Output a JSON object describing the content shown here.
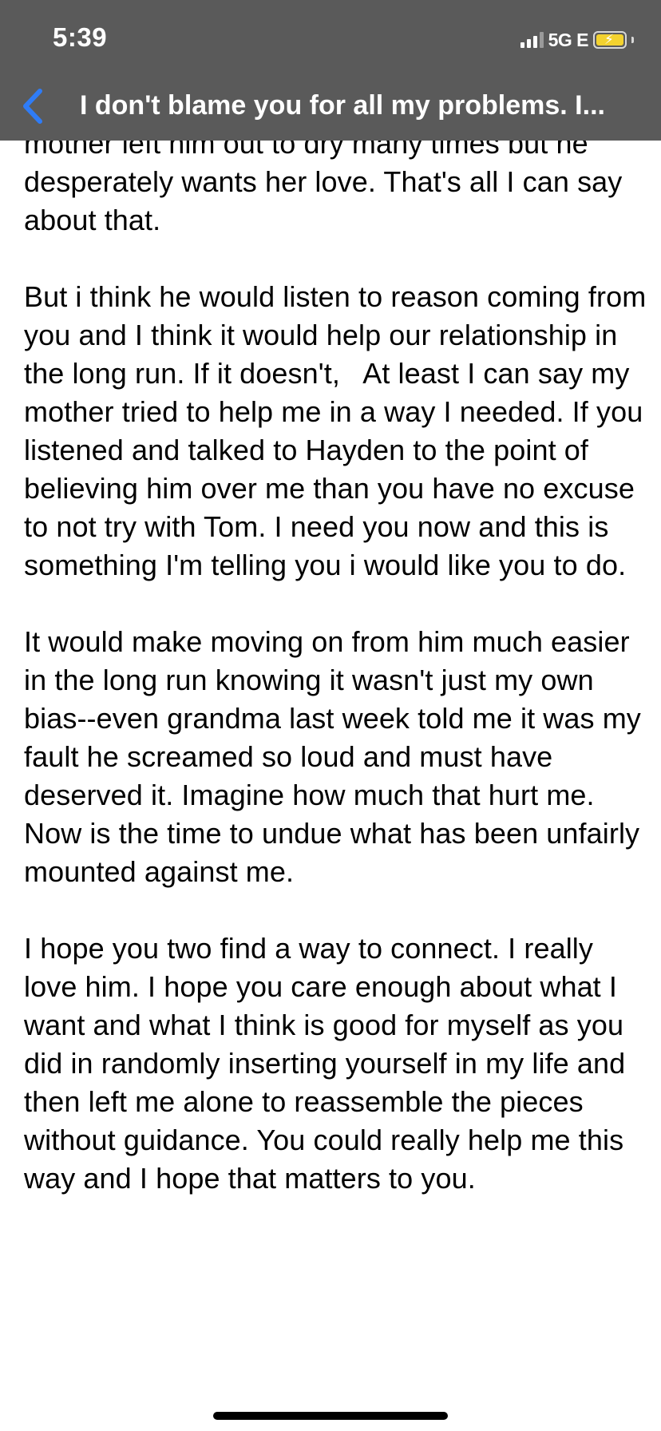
{
  "status_bar": {
    "time": "5:39",
    "network": "5G E",
    "battery_color": "#f3d22f"
  },
  "nav": {
    "back_icon": "chevron-left-icon",
    "back_color": "#2f7cf6",
    "title": "I don't blame you for all my problems. I..."
  },
  "message": {
    "paragraphs": [
      "mother left him out to dry many times but he desperately wants her love. That's all I can say about that.",
      "But i think he would listen to reason coming from you and I think it would help our relationship in the long run. If it doesn't,   At least I can say my mother tried to help me in a way I needed. If you listened and talked to Hayden to the point of believing him over me than you have no excuse to not try with Tom. I need you now and this is something I'm telling you i would like you to do.",
      "It would make moving on from him much easier in the long run knowing it wasn't just my own bias--even grandma last week told me it was my fault he screamed so loud and must have deserved it. Imagine how much that hurt me. Now is the time to undue what has been unfairly mounted against me.",
      "I hope you two find a way to connect. I really love him. I hope you care enough about what I want and what I think is good for myself as you did in randomly inserting yourself in my life and then left me alone to reassemble the pieces without guidance. You could really help me this way and I hope that matters to you."
    ]
  }
}
